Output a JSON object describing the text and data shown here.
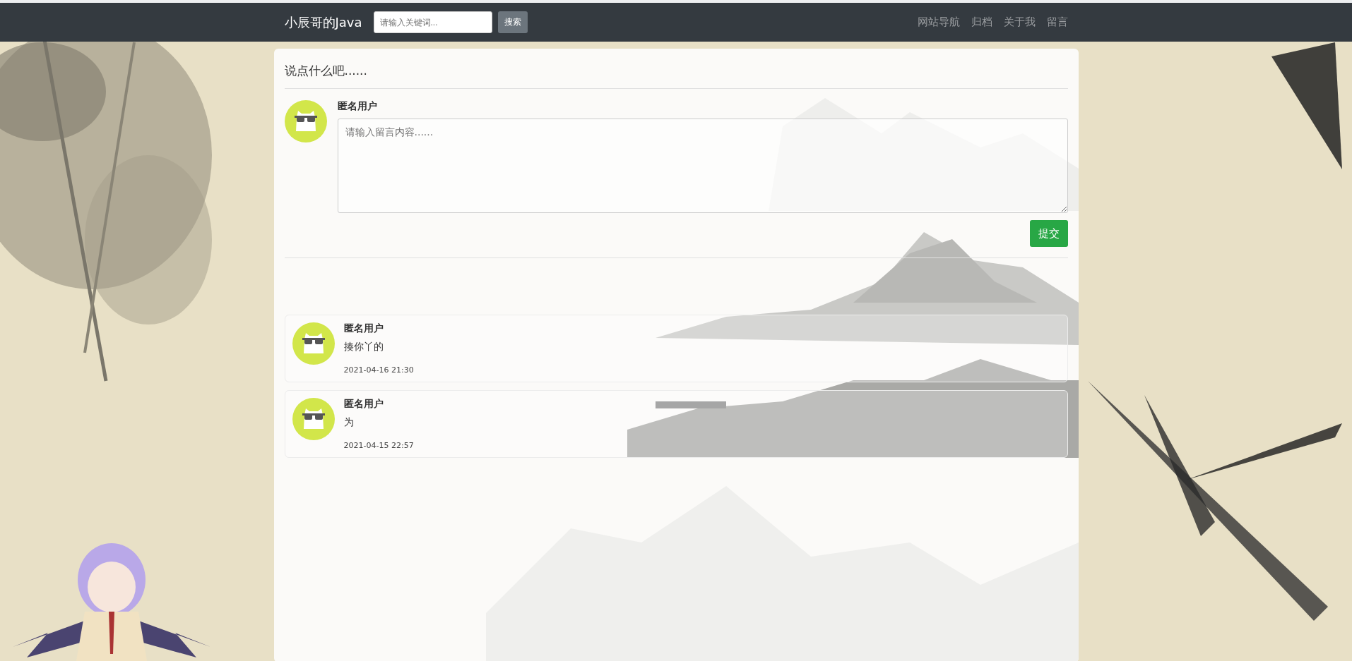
{
  "navbar": {
    "brand": "小辰哥的Java",
    "search": {
      "placeholder": "请输入关键词..."
    },
    "search_button": "搜索",
    "links": [
      "网站导航",
      "归档",
      "关于我",
      "留言"
    ]
  },
  "message_form": {
    "title": "说点什么吧......",
    "user": "匿名用户",
    "textarea": {
      "placeholder": "请输入留言内容......"
    },
    "submit": "提交"
  },
  "comments": [
    {
      "user": "匿名用户",
      "text": "揍你丫的",
      "time": "2021-04-16 21:30"
    },
    {
      "user": "匿名用户",
      "text": "为",
      "time": "2021-04-15 22:57"
    }
  ]
}
